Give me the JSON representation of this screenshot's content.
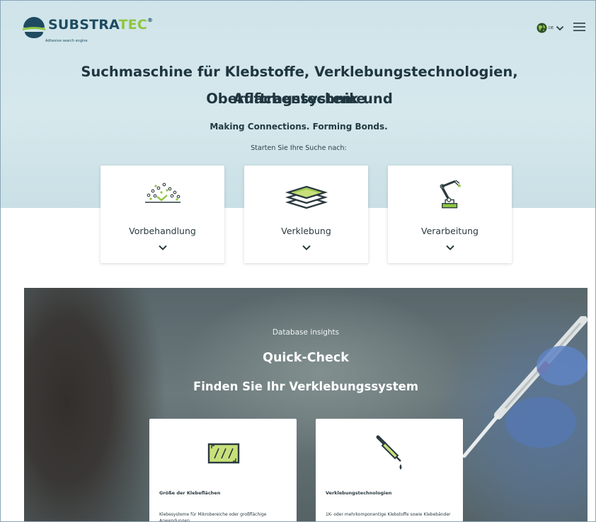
{
  "brand": {
    "name_part1": "SUBSTRA",
    "name_part2": "TEC",
    "mark": "®",
    "tagline": "Adhesive search engine",
    "colors": {
      "navy": "#1f4b61",
      "green": "#8fc640"
    }
  },
  "header": {
    "language": "DE",
    "icons": {
      "language": "globe-icon",
      "dropdown": "chevron-down-icon",
      "menu": "hamburger-menu-icon"
    }
  },
  "hero": {
    "title_line1": "Suchmaschine für Klebstoffe, Verklebungstechnologien, Oberflächentechnik und",
    "title_line2": "Auftragssysteme",
    "tagline": "Making Connections. Forming Bonds.",
    "start_prompt": "Starten Sie Ihre Suche nach:"
  },
  "categories": [
    {
      "label": "Vorbehandlung",
      "icon": "particles-surface-icon"
    },
    {
      "label": "Verklebung",
      "icon": "layers-icon"
    },
    {
      "label": "Verarbeitung",
      "icon": "robot-arm-icon"
    }
  ],
  "quick_check": {
    "kicker": "Database insights",
    "title": "Quick-Check",
    "subtitle": "Finden Sie Ihr Verklebungssystem",
    "cards": [
      {
        "heading": "Größe der Klebeflächen",
        "text": "Klebesysteme für Mikrobereiche oder großflächige Anwendungen",
        "icon": "surface-area-icon"
      },
      {
        "heading": "Verklebungstechnologien",
        "text": "1K- oder mehrkomponentige Klebstoffe sowie Klebebänder",
        "icon": "dropper-icon"
      }
    ]
  }
}
